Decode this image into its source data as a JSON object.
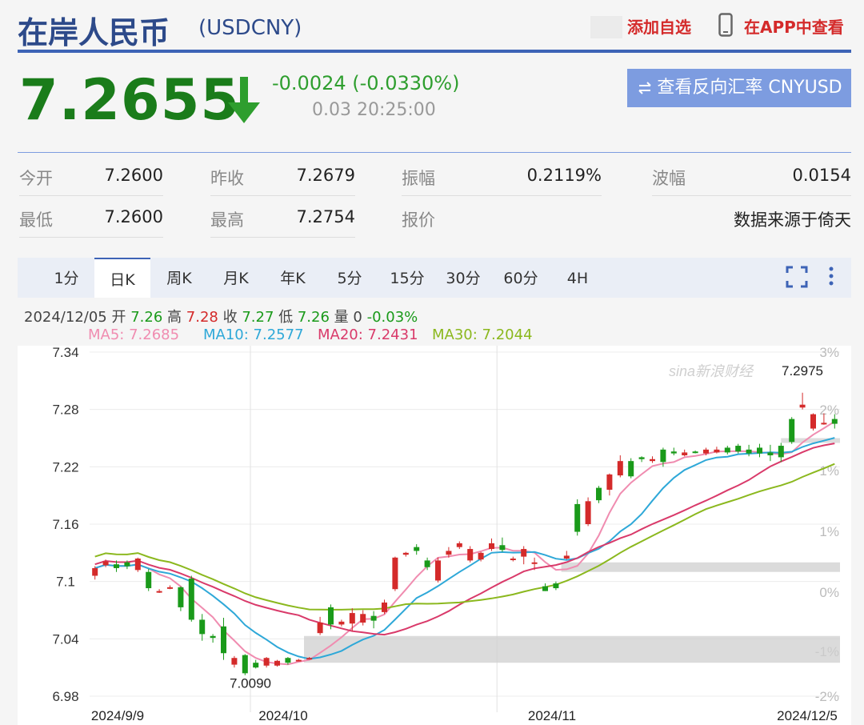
{
  "header": {
    "title": "在岸人民币",
    "code": "(USDCNY)",
    "add_favorite": "添加自选",
    "view_in_app": "在APP中查看"
  },
  "quote": {
    "price": "7.2655",
    "change": "-0.0024 (-0.0330%)",
    "time": "0.03 20:25:00",
    "reverse_button": "查看反向汇率 CNYUSD"
  },
  "stats": [
    {
      "label": "今开",
      "value": "7.2600"
    },
    {
      "label": "昨收",
      "value": "7.2679"
    },
    {
      "label": "振幅",
      "value": "0.2119%"
    },
    {
      "label": "波幅",
      "value": "0.0154"
    },
    {
      "label": "最低",
      "value": "7.2600"
    },
    {
      "label": "最高",
      "value": "7.2754"
    },
    {
      "label": "报价",
      "value": "数据来源于倚天"
    }
  ],
  "tabs": [
    "1分",
    "日K",
    "周K",
    "月K",
    "年K",
    "5分",
    "15分",
    "30分",
    "60分",
    "4H"
  ],
  "active_tab": "日K",
  "ohlc_info": {
    "date": "2024/12/05",
    "open_label": "开",
    "open": "7.26",
    "high_label": "高",
    "high": "7.28",
    "close_label": "收",
    "close": "7.27",
    "low_label": "低",
    "low": "7.26",
    "vol_label": "量",
    "vol": "0",
    "pct": "-0.03%"
  },
  "ma": [
    {
      "label": "MA5: 7.2685",
      "color": "#f08cb0"
    },
    {
      "label": "MA10: 7.2577",
      "color": "#2ea8d8"
    },
    {
      "label": "MA20: 7.2431",
      "color": "#d93a6a"
    },
    {
      "label": "MA30: 7.2044",
      "color": "#8bb81e"
    }
  ],
  "colors": {
    "up": "#d42a2a",
    "down": "#1a9a1a",
    "brand_blue": "#3d63b6",
    "price_green": "#1a7c1a"
  },
  "chart_data": {
    "type": "candlestick",
    "y_ticks": [
      "7.34",
      "7.28",
      "7.22",
      "7.16",
      "7.1",
      "7.04",
      "6.98"
    ],
    "ylim": [
      6.98,
      7.34
    ],
    "pct_ticks": [
      "3%",
      "2%",
      "1%",
      "1%",
      "0%",
      "-1%",
      "-2%"
    ],
    "x_ticks": [
      "2024/9/9",
      "2024/10",
      "2024/11",
      "2024/12/5"
    ],
    "annotations": {
      "max": "7.2975",
      "min": "7.0090"
    },
    "watermark": "sina新浪财经",
    "candles": [
      [
        7.106,
        7.114,
        7.102,
        7.116
      ],
      [
        7.117,
        7.121,
        7.115,
        7.123
      ],
      [
        7.118,
        7.114,
        7.11,
        7.122
      ],
      [
        7.12,
        7.116,
        7.113,
        7.122
      ],
      [
        7.112,
        7.124,
        7.11,
        7.125
      ],
      [
        7.11,
        7.093,
        7.09,
        7.113
      ],
      [
        7.09,
        7.09,
        7.088,
        7.092
      ],
      [
        7.094,
        7.094,
        7.092,
        7.096
      ],
      [
        7.094,
        7.073,
        7.069,
        7.095
      ],
      [
        7.103,
        7.06,
        7.058,
        7.106
      ],
      [
        7.06,
        7.045,
        7.038,
        7.066
      ],
      [
        7.043,
        7.041,
        7.036,
        7.045
      ],
      [
        7.053,
        7.025,
        7.018,
        7.062
      ],
      [
        7.013,
        7.02,
        7.01,
        7.022
      ],
      [
        7.023,
        7.004,
        7.002,
        7.024
      ],
      [
        7.015,
        7.01,
        7.009,
        7.018
      ],
      [
        7.012,
        7.02,
        7.01,
        7.021
      ],
      [
        7.012,
        7.017,
        7.011,
        7.018
      ],
      [
        7.02,
        7.015,
        7.013,
        7.021
      ],
      [
        7.018,
        7.018,
        7.017,
        7.019
      ],
      [
        7.02,
        7.02,
        7.019,
        7.021
      ],
      [
        7.046,
        7.057,
        7.044,
        7.063
      ],
      [
        7.073,
        7.055,
        7.05,
        7.076
      ],
      [
        7.055,
        7.058,
        7.053,
        7.06
      ],
      [
        7.056,
        7.067,
        7.048,
        7.072
      ],
      [
        7.057,
        7.066,
        7.054,
        7.07
      ],
      [
        7.064,
        7.059,
        7.051,
        7.069
      ],
      [
        7.068,
        7.078,
        7.066,
        7.081
      ],
      [
        7.092,
        7.125,
        7.09,
        7.126
      ],
      [
        7.128,
        7.13,
        7.126,
        7.131
      ],
      [
        7.136,
        7.132,
        7.128,
        7.139
      ],
      [
        7.122,
        7.115,
        7.112,
        7.125
      ],
      [
        7.101,
        7.122,
        7.099,
        7.125
      ],
      [
        7.128,
        7.132,
        7.125,
        7.136
      ],
      [
        7.136,
        7.14,
        7.134,
        7.142
      ],
      [
        7.122,
        7.134,
        7.12,
        7.137
      ],
      [
        7.123,
        7.13,
        7.121,
        7.131
      ],
      [
        7.134,
        7.14,
        7.132,
        7.145
      ],
      [
        7.138,
        7.133,
        7.131,
        7.146
      ],
      [
        7.124,
        7.124,
        7.121,
        7.126
      ],
      [
        7.126,
        7.134,
        7.118,
        7.137
      ],
      [
        7.12,
        7.12,
        7.112,
        7.125
      ],
      [
        7.095,
        7.09,
        7.09,
        7.098
      ],
      [
        7.098,
        7.093,
        7.091,
        7.1
      ],
      [
        7.124,
        7.127,
        7.123,
        7.132
      ],
      [
        7.181,
        7.152,
        7.148,
        7.186
      ],
      [
        7.16,
        7.184,
        7.158,
        7.188
      ],
      [
        7.198,
        7.185,
        7.182,
        7.2
      ],
      [
        7.196,
        7.212,
        7.19,
        7.213
      ],
      [
        7.211,
        7.226,
        7.209,
        7.232
      ],
      [
        7.226,
        7.21,
        7.208,
        7.229
      ],
      [
        7.23,
        7.228,
        7.225,
        7.231
      ],
      [
        7.226,
        7.228,
        7.224,
        7.231
      ],
      [
        7.238,
        7.225,
        7.22,
        7.24
      ],
      [
        7.236,
        7.234,
        7.232,
        7.24
      ],
      [
        7.232,
        7.235,
        7.231,
        7.238
      ],
      [
        7.236,
        7.235,
        7.234,
        7.237
      ],
      [
        7.234,
        7.238,
        7.232,
        7.24
      ],
      [
        7.235,
        7.238,
        7.234,
        7.241
      ],
      [
        7.24,
        7.235,
        7.233,
        7.242
      ],
      [
        7.242,
        7.236,
        7.234,
        7.244
      ],
      [
        7.238,
        7.234,
        7.231,
        7.243
      ],
      [
        7.24,
        7.234,
        7.23,
        7.244
      ],
      [
        7.235,
        7.232,
        7.226,
        7.243
      ],
      [
        7.242,
        7.23,
        7.225,
        7.245
      ],
      [
        7.27,
        7.246,
        7.244,
        7.272
      ],
      [
        7.282,
        7.285,
        7.28,
        7.2975
      ],
      [
        7.26,
        7.275,
        7.258,
        7.276
      ],
      [
        7.266,
        7.266,
        7.264,
        7.276
      ],
      [
        7.27,
        7.265,
        7.26,
        7.275
      ]
    ]
  }
}
